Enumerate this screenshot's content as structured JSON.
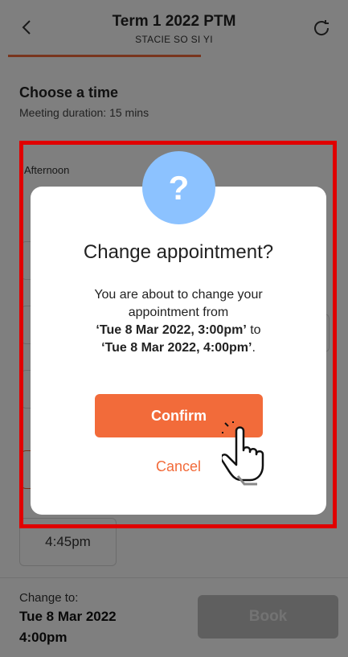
{
  "header": {
    "title": "Term 1 2022 PTM",
    "subtitle": "STACIE SO SI YI",
    "back_icon": "chevron-left-icon",
    "refresh_icon": "refresh-icon",
    "accent": "#f26b3a"
  },
  "content": {
    "section_title": "Choose a time",
    "section_subtitle": "Meeting duration: 15 mins",
    "period_label": "Afternoon",
    "visible_slot": "4:45pm"
  },
  "footer": {
    "change_to_label": "Change to:",
    "change_date": "Tue 8 Mar 2022",
    "change_time": "4:00pm",
    "book_label": "Book"
  },
  "modal": {
    "icon": "question-mark-icon",
    "icon_glyph": "?",
    "title": "Change appointment?",
    "body_line1": "You are about to change your",
    "body_line2": "appointment from",
    "from_value": "‘Tue 8 Mar 2022, 3:00pm’",
    "to_word": " to",
    "to_value": "‘Tue 8 Mar 2022, 4:00pm’",
    "period": ".",
    "confirm_label": "Confirm",
    "cancel_label": "Cancel",
    "icon_color": "#8cc2ff"
  },
  "annotation": {
    "highlight_color": "#e00000",
    "pointer_icon": "hand-pointer-icon"
  }
}
